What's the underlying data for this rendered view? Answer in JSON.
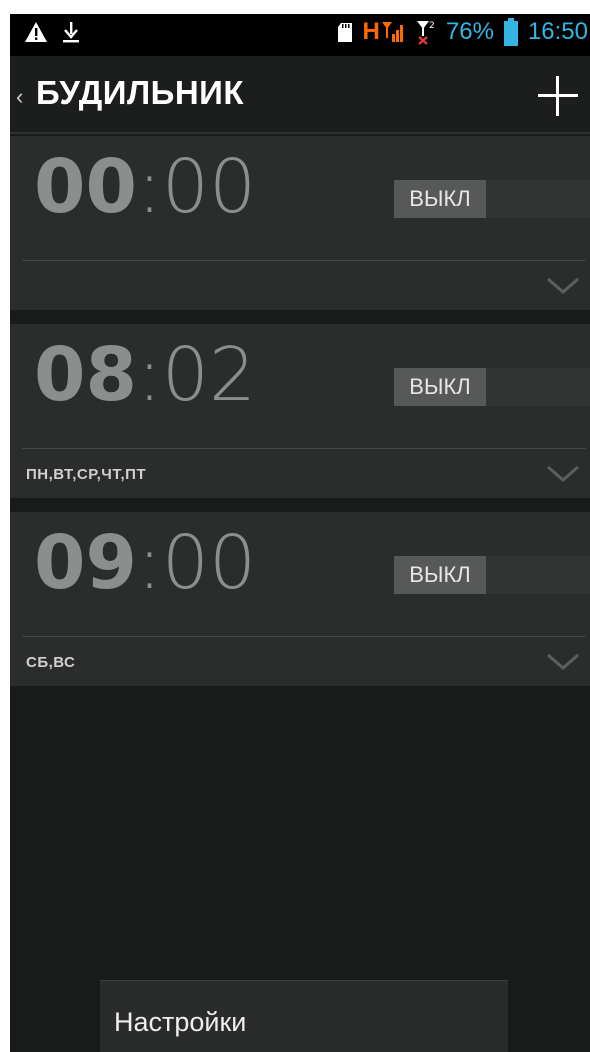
{
  "status_bar": {
    "icons_left": [
      "warning-icon",
      "download-icon"
    ],
    "icons_right": [
      "sd-card-icon",
      "signal-icon",
      "no-signal-icon",
      "battery-icon"
    ],
    "network": "H",
    "battery_percent": "76%",
    "time": "16:50",
    "colors": {
      "accent": "#33b5e5",
      "network": "#ff6a00"
    }
  },
  "action_bar": {
    "title": "БУДИЛЬНИК",
    "add_icon": "plus-icon",
    "back_icon": "back-caret-icon"
  },
  "alarms": [
    {
      "hours": "00",
      "separator": ":",
      "minutes": "00",
      "toggle_label": "ВЫКЛ",
      "days": ""
    },
    {
      "hours": "08",
      "separator": ":",
      "minutes": "02",
      "toggle_label": "ВЫКЛ",
      "days": "ПН,ВТ,СР,ЧТ,ПТ"
    },
    {
      "hours": "09",
      "separator": ":",
      "minutes": "00",
      "toggle_label": "ВЫКЛ",
      "days": "СБ,ВС"
    }
  ],
  "menu": {
    "items": [
      {
        "label": "Настройки"
      }
    ]
  }
}
